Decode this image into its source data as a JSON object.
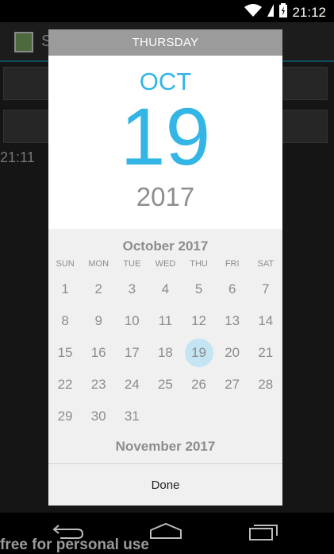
{
  "status_bar": {
    "time": "21:12"
  },
  "background_app": {
    "title": "S",
    "time": "21:11"
  },
  "dialog": {
    "day_of_week": "THURSDAY",
    "month_short": "OCT",
    "day": "19",
    "year": "2017",
    "calendar": {
      "current_month_label": "October 2017",
      "weekdays": [
        "SUN",
        "MON",
        "TUE",
        "WED",
        "THU",
        "FRI",
        "SAT"
      ],
      "weeks": [
        [
          "1",
          "2",
          "3",
          "4",
          "5",
          "6",
          "7"
        ],
        [
          "8",
          "9",
          "10",
          "11",
          "12",
          "13",
          "14"
        ],
        [
          "15",
          "16",
          "17",
          "18",
          "19",
          "20",
          "21"
        ],
        [
          "22",
          "23",
          "24",
          "25",
          "26",
          "27",
          "28"
        ],
        [
          "29",
          "30",
          "31",
          "",
          "",
          "",
          ""
        ]
      ],
      "selected_day": "19",
      "next_month_label": "November 2017"
    },
    "done_label": "Done"
  },
  "watermark": "free for personal use",
  "colors": {
    "accent": "#33b5e5",
    "selected_circle": "#c3e4f2",
    "header_gray": "#9b9b9b"
  }
}
